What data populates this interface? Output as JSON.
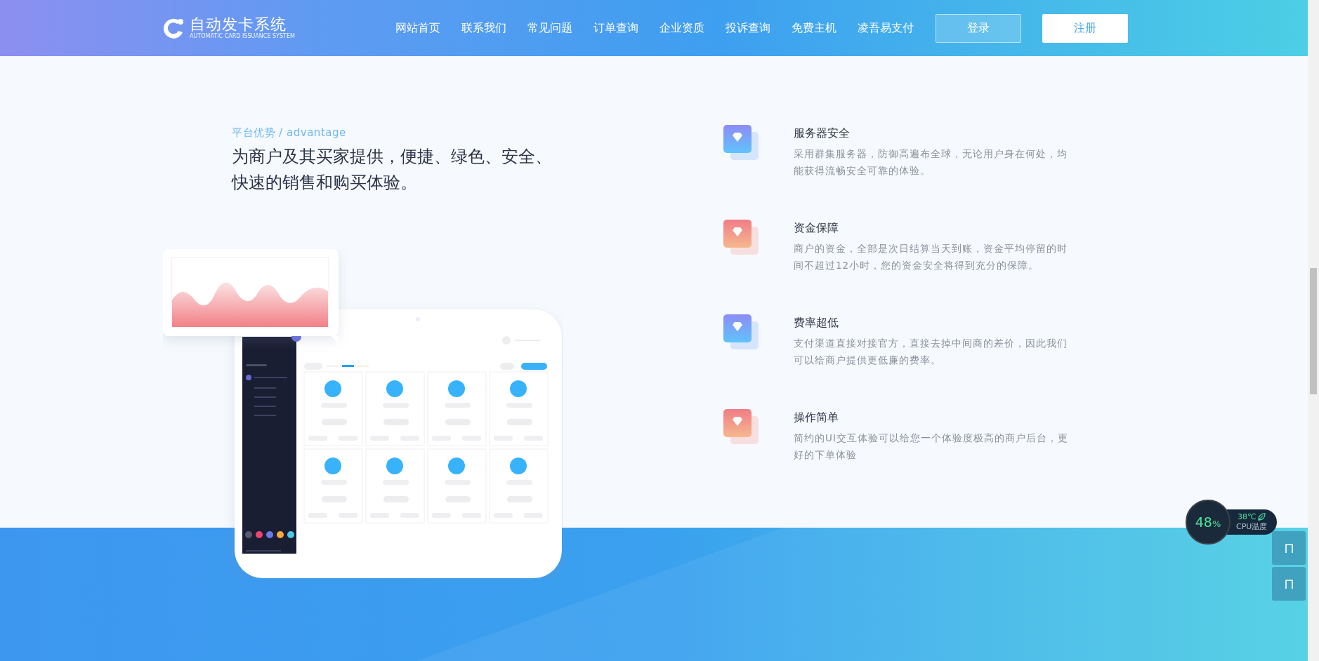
{
  "header": {
    "logo": {
      "name": "自动发卡系统",
      "tagline": "AUTOMATIC CARD ISSUANCE SYSTEM"
    },
    "nav": [
      "网站首页",
      "联系我们",
      "常见问题",
      "订单查询",
      "企业资质",
      "投诉查询",
      "免费主机",
      "凌吾易支付"
    ],
    "login": "登录",
    "register": "注册"
  },
  "advantage": {
    "label": "平台优势 / advantage",
    "headline": "为商户及其买家提供，便捷、绿色、安全、快速的销售和购买体验。"
  },
  "features": [
    {
      "kind": "cool",
      "title": "服务器安全",
      "text": "采用群集服务器，防御高遍布全球，无论用户身在何处，均能获得流畅安全可靠的体验。"
    },
    {
      "kind": "warm",
      "title": "资金保障",
      "text": "商户的资金，全部是次日结算当天到账，资金平均停留的时间不超过12小时，您的资金安全将得到充分的保障。"
    },
    {
      "kind": "cool",
      "title": "费率超低",
      "text": "支付渠道直接对接官方，直接去掉中间商的差价，因此我们可以给商户提供更低廉的费率。"
    },
    {
      "kind": "warm",
      "title": "操作简单",
      "text": "简约的UI交互体验可以给您一个体验度极高的商户后台，更好的下单体验"
    }
  ],
  "cpu_widget": {
    "percent": "48",
    "unit": "%",
    "temperature": "38℃",
    "label": "CPU温度"
  }
}
